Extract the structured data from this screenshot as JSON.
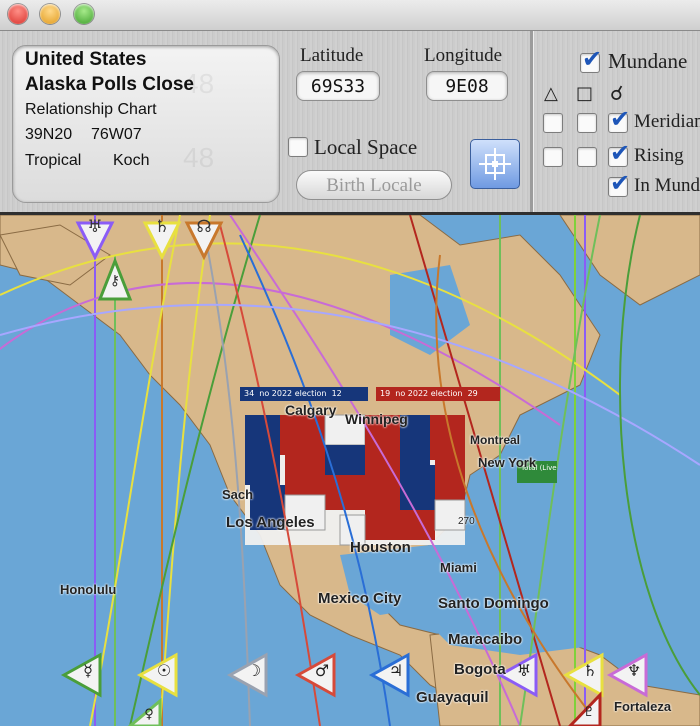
{
  "window": {
    "lights": [
      "#ee4b44",
      "#f3b13a",
      "#5fc040"
    ]
  },
  "chart_info": {
    "line1": "United States",
    "line2": "Alaska Polls Close",
    "line3": "Relationship Chart",
    "coord_lat": "39N20",
    "coord_lon": "76W07",
    "zodiac": "Tropical",
    "houses": "Koch",
    "ghost_1": "48",
    "ghost_2": "48"
  },
  "latitude": {
    "label": "Latitude",
    "value": "69S33"
  },
  "longitude": {
    "label": "Longitude",
    "value": "9E08"
  },
  "local_space": {
    "label": "Local Space",
    "checked": false
  },
  "birth_locale": {
    "label": "Birth Locale"
  },
  "right_panel": {
    "mundane_label": "Mundane",
    "symbols": [
      "△",
      "□",
      "☌"
    ],
    "rows": [
      {
        "label": "Meridian"
      },
      {
        "label": "Rising"
      },
      {
        "label": "In Mund"
      }
    ]
  },
  "map": {
    "labels": [
      "Honolulu",
      "Los Angeles",
      "Sach",
      "Houston",
      "Mexico City",
      "Santo Domingo",
      "Maracaibo",
      "Bogota",
      "Guayaquil",
      "Fortaleza",
      "New York",
      "Calgary",
      "Winnipeg",
      "Miami",
      "Montreal"
    ],
    "overlay": {
      "banner_left": "no 2022 election",
      "banner_right": "no 2022 election",
      "nums": [
        "34",
        "12",
        "19",
        "29"
      ],
      "total_label": "Total (Live)",
      "tiny_value": "270"
    },
    "planets": {
      "top": [
        "♅",
        "♄",
        "☊",
        "⚷"
      ],
      "bottom": [
        "☿",
        "☉",
        "☽",
        "♂",
        "♃",
        "♅",
        "♄",
        "♆",
        "♀",
        "♇"
      ]
    },
    "colors": {
      "ocean": "#6aa6d6",
      "land": "#d8b88b",
      "red_state": "#b3261e",
      "blue_state": "#16367a"
    }
  }
}
